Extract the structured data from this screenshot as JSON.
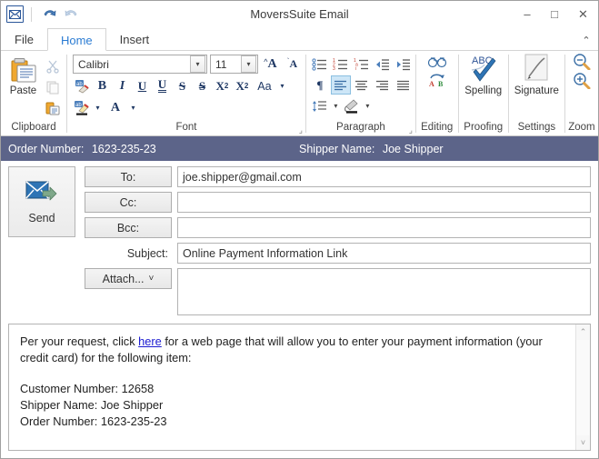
{
  "window": {
    "title": "MoversSuite Email",
    "app_icon": "mail-icon",
    "quick_access": [
      {
        "name": "undo-icon",
        "label": "Undo"
      },
      {
        "name": "redo-icon",
        "label": "Redo"
      }
    ],
    "controls": {
      "minimize": "–",
      "maximize": "□",
      "close": "✕"
    }
  },
  "tabs": [
    {
      "label": "File",
      "active": false
    },
    {
      "label": "Home",
      "active": true
    },
    {
      "label": "Insert",
      "active": false
    }
  ],
  "ribbon": {
    "collapse_glyph": "⌃",
    "groups": [
      {
        "label": "Clipboard"
      },
      {
        "label": "Font"
      },
      {
        "label": "Paragraph"
      },
      {
        "label": "Editing"
      },
      {
        "label": "Proofing"
      },
      {
        "label": "Settings"
      },
      {
        "label": "Zoom"
      }
    ],
    "clipboard": {
      "paste_label": "Paste",
      "cut_icon": "scissors-icon",
      "copy_icon": "copy-icon",
      "format_painter_icon": "format-painter-icon"
    },
    "font": {
      "font_name": "Calibri",
      "font_size": "11",
      "grow_font": "A",
      "shrink_font": "A",
      "clear_formatting": "clear-formatting-icon",
      "bold": "B",
      "italic": "I",
      "underline": "U",
      "double_underline": "U",
      "strikethrough": "S",
      "double_strikethrough": "S",
      "superscript": "X",
      "superscript_sup": "2",
      "subscript": "X",
      "subscript_sub": "2",
      "change_case": "Aa",
      "text_highlight": "highlighter-icon",
      "font_color": "A",
      "dropdown_arrow": "▾"
    },
    "paragraph": {
      "bullets": "bullet-list-icon",
      "numbering": "numbered-list-icon",
      "multilevel": "multilevel-list-icon",
      "decrease_indent": "decrease-indent-icon",
      "increase_indent": "increase-indent-icon",
      "show_marks": "¶",
      "align_left": "align-left-icon",
      "align_center": "align-center-icon",
      "align_right": "align-right-icon",
      "justify": "justify-icon",
      "line_spacing": "line-spacing-icon",
      "shading": "shading-icon",
      "dropdown_arrow": "▾"
    },
    "editing": {
      "find": "binoculars-icon",
      "replace": "replace-icon",
      "replace_a": "A",
      "replace_b": "B"
    },
    "proofing": {
      "spelling_label": "Spelling",
      "spelling_abc": "ABC",
      "spelling_icon": "spell-check-icon"
    },
    "settings": {
      "signature_label": "Signature",
      "signature_icon": "signature-icon"
    },
    "zoom": {
      "zoom_out": "zoom-out-icon",
      "zoom_in": "zoom-in-icon"
    }
  },
  "infobar": {
    "order_label": "Order Number:",
    "order_value": "1623-235-23",
    "shipper_label": "Shipper Name:",
    "shipper_value": "Joe Shipper",
    "background": "#5c6489"
  },
  "compose": {
    "send_label": "Send",
    "send_icon": "send-mail-icon",
    "to_label": "To:",
    "to_value": "joe.shipper@gmail.com",
    "cc_label": "Cc:",
    "cc_value": "",
    "bcc_label": "Bcc:",
    "bcc_value": "",
    "subject_label": "Subject:",
    "subject_value": "Online Payment Information Link",
    "attach_label": "Attach...",
    "attach_arrow": "˅",
    "attachments": ""
  },
  "body": {
    "line1_pre": "Per your request, click ",
    "link_text": "here",
    "line1_post": " for a web page that will allow you to enter your payment information",
    "line2": "(your credit card) for the following item:",
    "details": [
      "Customer Number: 12658",
      "Shipper Name: Joe Shipper",
      "Order Number: 1623-235-23"
    ],
    "scroll_up": "⌃",
    "scroll_down": "˅"
  }
}
